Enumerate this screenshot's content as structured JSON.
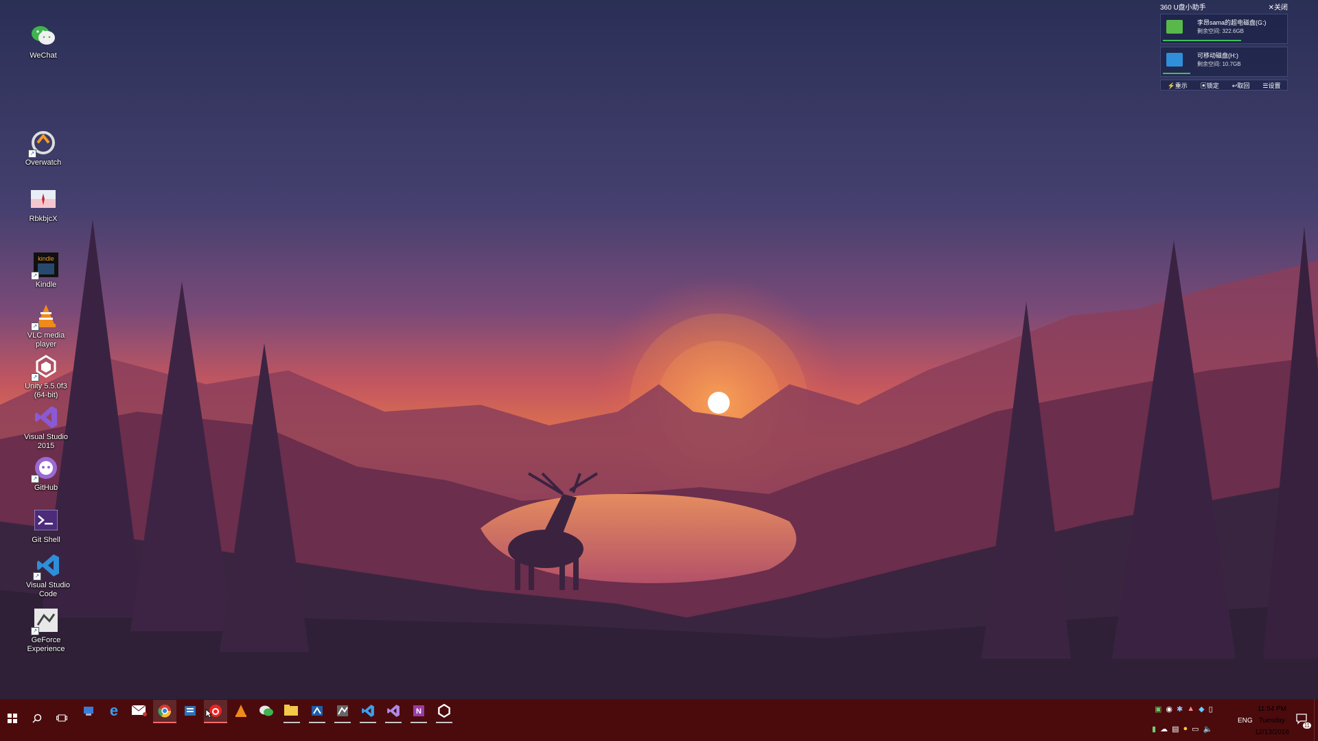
{
  "desktop": {
    "icons": [
      {
        "label": "WeChat"
      },
      {
        "label": "Overwatch"
      },
      {
        "label": "RbkbjcX"
      },
      {
        "label": "Kindle"
      },
      {
        "label": "VLC media player"
      },
      {
        "label": "Unity 5.5.0f3 (64-bit)"
      },
      {
        "label": "Visual Studio 2015"
      },
      {
        "label": "GitHub"
      },
      {
        "label": "Git Shell"
      },
      {
        "label": "Visual Studio Code"
      },
      {
        "label": "GeForce Experience"
      }
    ]
  },
  "usb_widget": {
    "title": "360 U盘小助手",
    "close_label": "✕关闭",
    "drives": [
      {
        "name": "李昂sama的超电磁盘(G:)",
        "space": "剩余空间: 322.6GB",
        "fill": 0.62,
        "color": "#59b84a"
      },
      {
        "name": "可移动磁盘(H:)",
        "space": "剩余空间: 10.7GB",
        "fill": 0.22,
        "color": "#2f8fd8"
      }
    ],
    "actions": [
      "重示",
      "锁定",
      "取回",
      "设置"
    ]
  },
  "taskbar": {
    "apps": [
      "Team Explorer",
      "Edge",
      "Mail",
      "Chrome",
      "Azure Storage Explorer",
      "NetEase Music",
      "VLC",
      "WeChat",
      "File Explorer",
      "Azure",
      "GeForce",
      "Visual Studio Code",
      "Visual Studio",
      "OneNote",
      "Unity"
    ],
    "language": "ENG",
    "time": "11:54 PM",
    "day": "Tuesday",
    "date": "12/13/2016",
    "notification_count": "11"
  },
  "colors": {
    "taskbar": "#4b0b0d",
    "sky_top": "#2a2f56",
    "sun": "#ffffff"
  }
}
